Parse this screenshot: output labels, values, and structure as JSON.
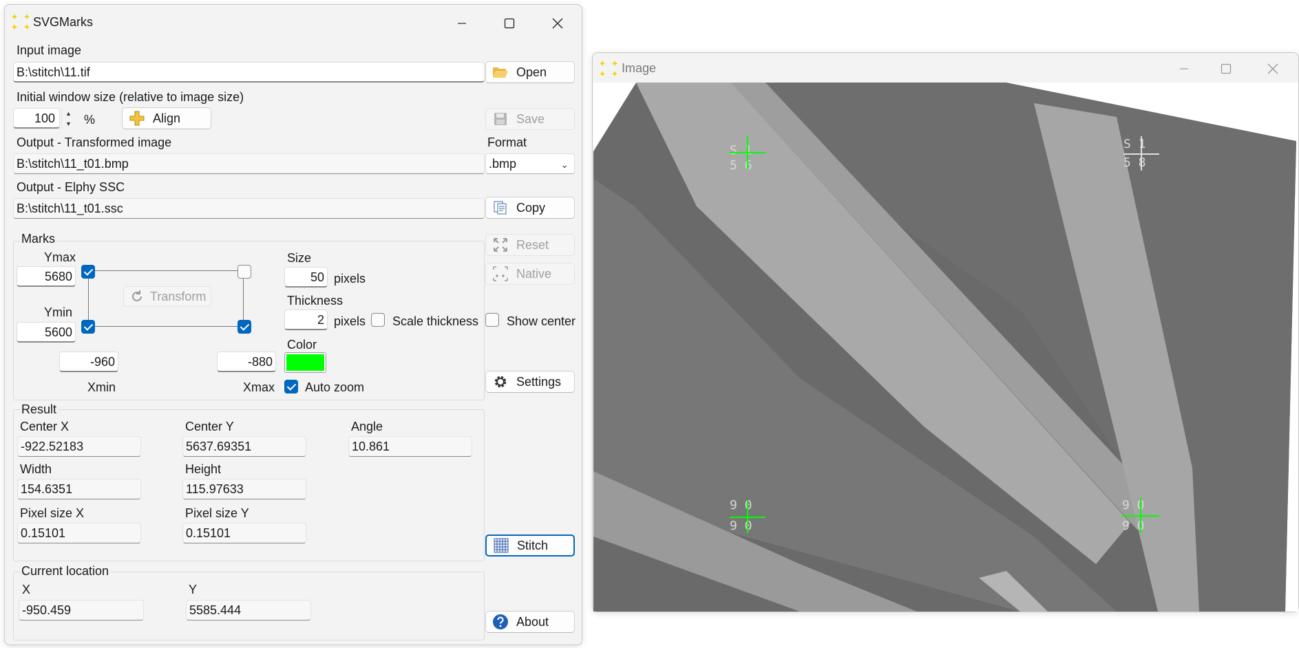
{
  "main_window": {
    "title": "SVGMarks",
    "input_image_label": "Input image",
    "input_image_value": "B:\\stitch\\11.tif",
    "open_label": "Open",
    "initial_size_label": "Initial window size (relative to image size)",
    "initial_size_value": "100",
    "percent_label": "%",
    "align_label": "Align",
    "save_label": "Save",
    "output_transformed_label": "Output - Transformed image",
    "output_transformed_value": "B:\\stitch\\11_t01.bmp",
    "format_label": "Format",
    "format_value": ".bmp",
    "output_ssc_label": "Output - Elphy SSC",
    "output_ssc_value": "B:\\stitch\\11_t01.ssc",
    "copy_label": "Copy",
    "reset_label": "Reset",
    "native_label": "Native",
    "show_center_label": "Show center",
    "settings_label": "Settings",
    "stitch_label": "Stitch",
    "about_label": "About"
  },
  "marks": {
    "title": "Marks",
    "ymax_label": "Ymax",
    "ymax_value": "5680",
    "ymin_label": "Ymin",
    "ymin_value": "5600",
    "xmin_label": "Xmin",
    "xmin_value": "-960",
    "xmax_label": "Xmax",
    "xmax_value": "-880",
    "transform_label": "Transform",
    "size_label": "Size",
    "size_value": "50",
    "size_unit": "pixels",
    "thickness_label": "Thickness",
    "thickness_value": "2",
    "thickness_unit": "pixels",
    "scale_thickness_label": "Scale thickness",
    "color_label": "Color",
    "color_value": "#00ff00",
    "auto_zoom_label": "Auto zoom",
    "corner_top_left_checked": true,
    "corner_top_right_checked": false,
    "corner_bottom_left_checked": true,
    "corner_bottom_right_checked": true,
    "auto_zoom_checked": true,
    "scale_thickness_checked": false,
    "show_center_checked": false
  },
  "result": {
    "title": "Result",
    "center_x_label": "Center X",
    "center_x_value": "-922.52183",
    "center_y_label": "Center Y",
    "center_y_value": "5637.69351",
    "angle_label": "Angle",
    "angle_value": "10.861",
    "width_label": "Width",
    "width_value": "154.6351",
    "height_label": "Height",
    "height_value": "115.97633",
    "pixel_size_x_label": "Pixel size X",
    "pixel_size_x_value": "0.15101",
    "pixel_size_y_label": "Pixel size Y",
    "pixel_size_y_value": "0.15101"
  },
  "current_location": {
    "title": "Current location",
    "x_label": "X",
    "x_value": "-950.459",
    "y_label": "Y",
    "y_value": "5585.444"
  },
  "image_window": {
    "title": "Image",
    "mark_color": "#00ff00"
  },
  "colors": {
    "accent": "#0067c0",
    "window_bg": "#f3f3f3",
    "app_icon": "#f5d000"
  }
}
